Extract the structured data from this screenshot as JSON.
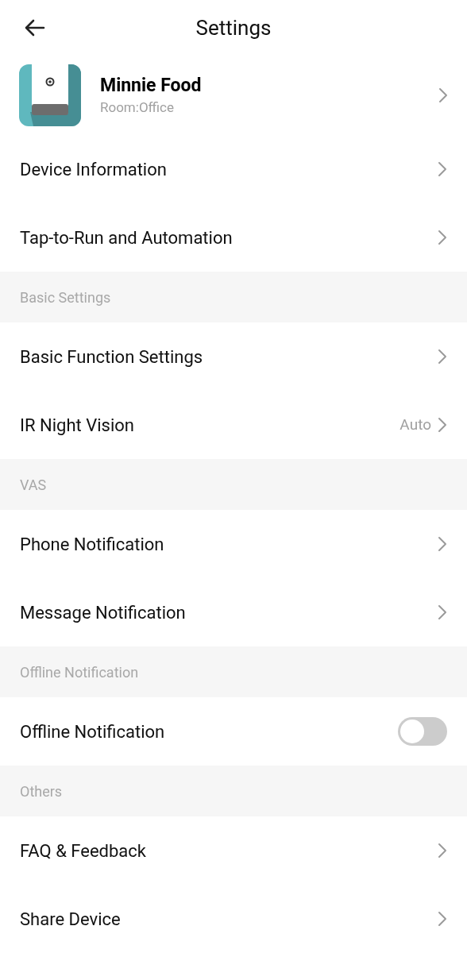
{
  "header": {
    "title": "Settings"
  },
  "device": {
    "name": "Minnie Food",
    "room": "Room:Office"
  },
  "groups": [
    {
      "items": [
        {
          "kind": "link",
          "label": "Device Information"
        },
        {
          "kind": "link",
          "label": "Tap-to-Run and Automation"
        }
      ]
    },
    {
      "title": "Basic Settings",
      "items": [
        {
          "kind": "link",
          "label": "Basic Function Settings"
        },
        {
          "kind": "link",
          "label": "IR Night Vision",
          "value": "Auto"
        }
      ]
    },
    {
      "title": "VAS",
      "items": [
        {
          "kind": "link",
          "label": "Phone Notification"
        },
        {
          "kind": "link",
          "label": "Message Notification"
        }
      ]
    },
    {
      "title": "Offline Notification",
      "items": [
        {
          "kind": "toggle",
          "label": "Offline Notification",
          "on": false
        }
      ]
    },
    {
      "title": "Others",
      "items": [
        {
          "kind": "link",
          "label": "FAQ & Feedback"
        },
        {
          "kind": "link",
          "label": "Share Device"
        }
      ]
    }
  ]
}
